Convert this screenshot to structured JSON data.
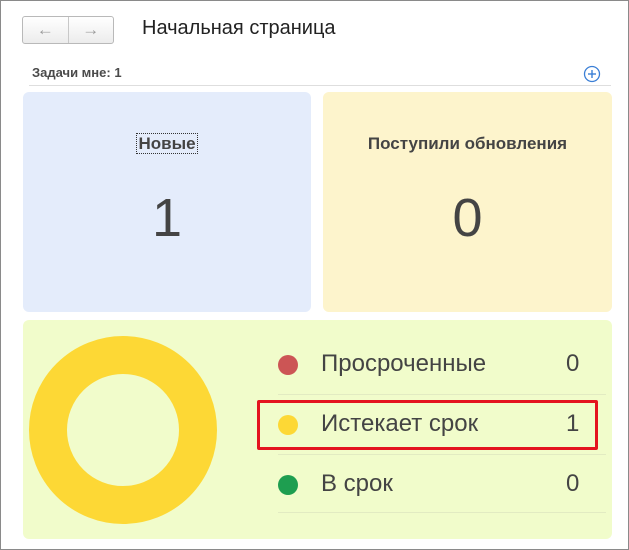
{
  "header": {
    "back_icon": "arrow-left-icon",
    "forward_icon": "arrow-right-icon",
    "title": "Начальная страница"
  },
  "tasks": {
    "label": "Задачи мне: 1",
    "add_icon": "plus-circle-icon"
  },
  "tiles": {
    "new": {
      "label": "Новые",
      "count": "1",
      "color": "#e4ecfb"
    },
    "updated": {
      "label": "Поступили обновления",
      "count": "0",
      "color": "#fdf4cc"
    }
  },
  "deadlines": {
    "background": "#f1fccb",
    "items": [
      {
        "label": "Просроченные",
        "count": "0",
        "color": "#cc5555"
      },
      {
        "label": "Истекает срок",
        "count": "1",
        "color": "#fdd835"
      },
      {
        "label": "В срок",
        "count": "0",
        "color": "#1e9e50"
      }
    ],
    "highlighted_item": "Истекает срок"
  },
  "chart_data": {
    "type": "pie",
    "categories": [
      "Просроченные",
      "Истекает срок",
      "В срок"
    ],
    "values": [
      0,
      1,
      0
    ],
    "colors": [
      "#cc5555",
      "#fdd835",
      "#1e9e50"
    ],
    "donut": true
  }
}
